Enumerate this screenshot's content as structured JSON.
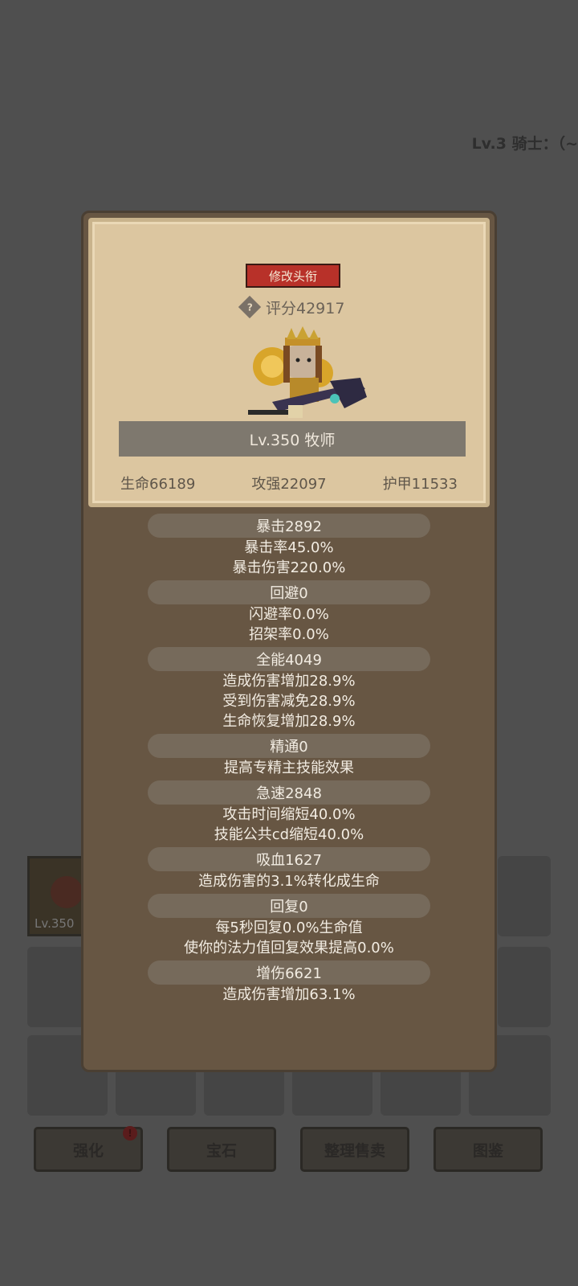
{
  "background": {
    "header_text": "Lv.3 骑士：（~",
    "equip_slot_level": "Lv.350",
    "buttons": [
      {
        "label": "强化",
        "badge": "!"
      },
      {
        "label": "宝石"
      },
      {
        "label": "整理售卖"
      },
      {
        "label": "图鉴"
      }
    ]
  },
  "card": {
    "change_title_label": "修改头衔",
    "help_icon": "?",
    "score_label": "评分42917",
    "name_level": "Lv.350 牧师",
    "stats": {
      "hp": "生命66189",
      "attack": "攻强22097",
      "armor": "护甲11533"
    }
  },
  "attributes": [
    {
      "head": "暴击2892",
      "lines": [
        "暴击率45.0%",
        "暴击伤害220.0%"
      ]
    },
    {
      "head": "回避0",
      "lines": [
        "闪避率0.0%",
        "招架率0.0%"
      ]
    },
    {
      "head": "全能4049",
      "lines": [
        "造成伤害增加28.9%",
        "受到伤害减免28.9%",
        "生命恢复增加28.9%"
      ]
    },
    {
      "head": "精通0",
      "lines": [
        "提高专精主技能效果"
      ]
    },
    {
      "head": "急速2848",
      "lines": [
        "攻击时间缩短40.0%",
        "技能公共cd缩短40.0%"
      ]
    },
    {
      "head": "吸血1627",
      "lines": [
        "造成伤害的3.1%转化成生命"
      ]
    },
    {
      "head": "回复0",
      "lines": [
        "每5秒回复0.0%生命值",
        "使你的法力值回复效果提高0.0%"
      ]
    },
    {
      "head": "增伤6621",
      "lines": [
        "造成伤害增加63.1%"
      ]
    }
  ],
  "colors": {
    "overlay_bg": "#4f4f4f",
    "modal_bg": "#675643",
    "card_bg": "#dcc6a0",
    "title_btn": "#b83129",
    "attr_head_bg": "#766a5b"
  }
}
